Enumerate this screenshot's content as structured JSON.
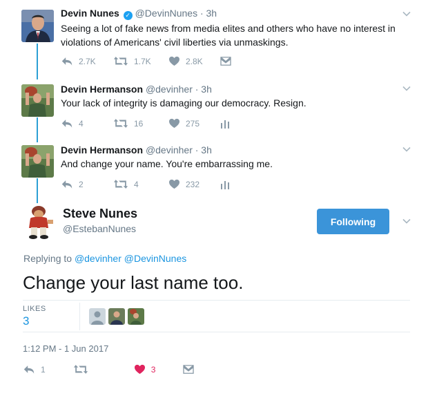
{
  "tweets": [
    {
      "name": "Devin Nunes",
      "handle": "@DevinNunes",
      "time": "· 3h",
      "text": "Seeing a lot of fake news from media elites and others who have no interest in violations of Americans' civil liberties via unmaskings.",
      "replies": "2.7K",
      "retweets": "1.7K",
      "likes": "2.8K"
    },
    {
      "name": "Devin Hermanson",
      "handle": "@devinher",
      "time": "· 3h",
      "text": "Your lack of integrity is damaging our democracy. Resign.",
      "replies": "4",
      "retweets": "16",
      "likes": "275"
    },
    {
      "name": "Devin Hermanson",
      "handle": "@devinher",
      "time": "· 3h",
      "text": "And change your name. You're embarrassing me.",
      "replies": "2",
      "retweets": "4",
      "likes": "232"
    }
  ],
  "main": {
    "name": "Steve Nunes",
    "handle": "@EstebanNunes",
    "follow_label": "Following",
    "replying_prefix": "Replying to",
    "replying_to_1": "@devinher",
    "replying_to_2": "@DevinNunes",
    "text": "Change your last name too.",
    "likes_label": "LIKES",
    "likes_count": "3",
    "timestamp": "1:12 PM - 1 Jun 2017",
    "replies": "1",
    "likes": "3"
  },
  "colors": {
    "accent": "#1b95e0",
    "follow_button": "#3b94d9",
    "thread_line": "#2b9fd4",
    "like_active": "#e0245e"
  },
  "icons": [
    "reply-icon",
    "retweet-icon",
    "heart-icon",
    "dm-icon",
    "analytics-icon",
    "chevron-down-icon",
    "verified-icon"
  ]
}
